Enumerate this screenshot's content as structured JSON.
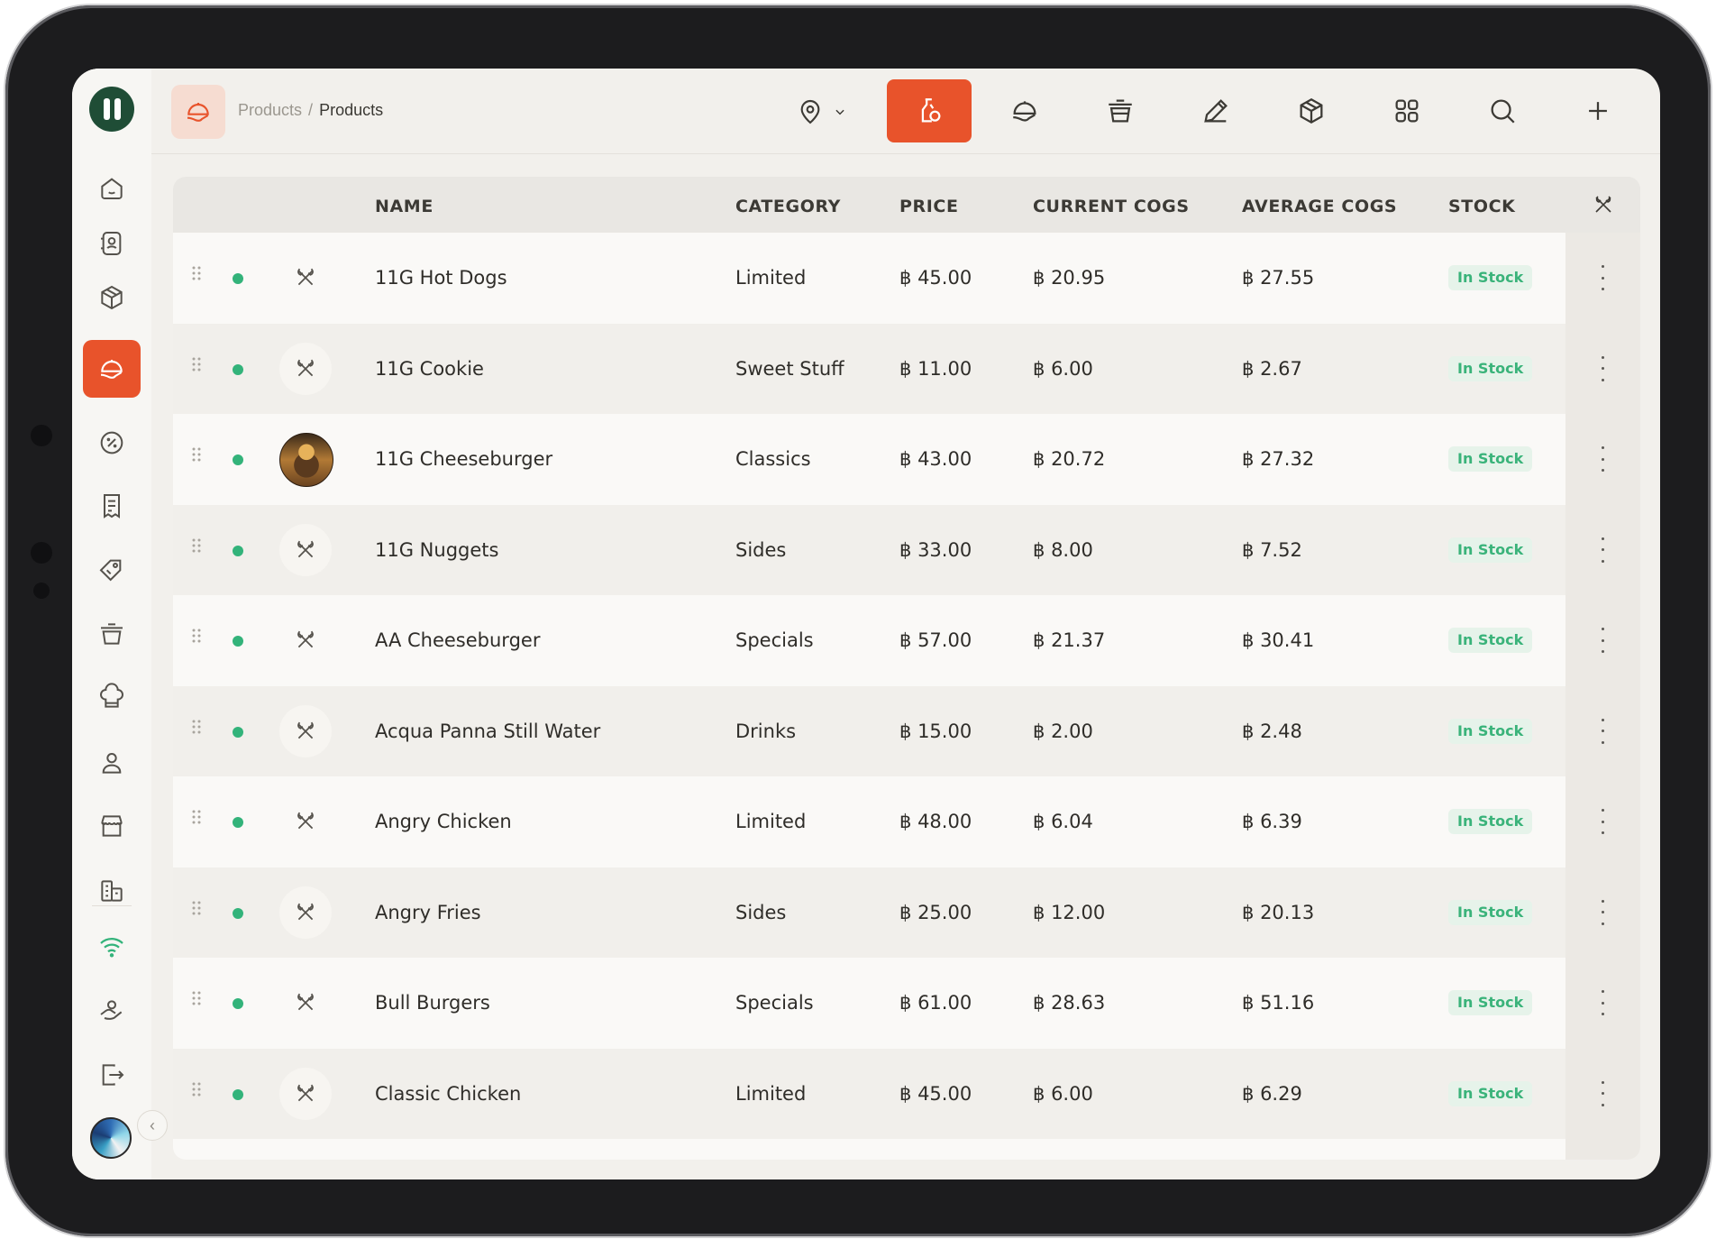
{
  "breadcrumb": {
    "parent": "Products",
    "separator": "/",
    "current": "Products"
  },
  "toolbar": {
    "location_icon": "location-pin-icon",
    "buttons": [
      {
        "name": "ingredients-tab",
        "icon": "bottle-icon",
        "active": true
      },
      {
        "name": "products-tab",
        "icon": "food-tray-icon",
        "active": false
      },
      {
        "name": "pots-tab",
        "icon": "pot-icon",
        "active": false
      },
      {
        "name": "edit-tab",
        "icon": "pencil-icon",
        "active": false
      },
      {
        "name": "packages-tab",
        "icon": "box-icon",
        "active": false
      },
      {
        "name": "grid-tab",
        "icon": "grid-icon",
        "active": false
      },
      {
        "name": "search",
        "icon": "search-icon",
        "active": false
      },
      {
        "name": "add",
        "icon": "plus-icon",
        "active": false
      }
    ]
  },
  "sidebar": {
    "items": [
      {
        "name": "home",
        "icon": "home-icon"
      },
      {
        "name": "contacts",
        "icon": "contact-card-icon"
      },
      {
        "name": "inventory",
        "icon": "box-icon"
      },
      {
        "name": "products",
        "icon": "food-tray-icon",
        "active": true
      },
      {
        "name": "discounts",
        "icon": "percent-badge-icon"
      },
      {
        "name": "invoices",
        "icon": "receipt-icon"
      },
      {
        "name": "tags",
        "icon": "tag-icon"
      },
      {
        "name": "cooking",
        "icon": "pot-icon"
      },
      {
        "name": "chef",
        "icon": "chef-hat-icon"
      },
      {
        "name": "staff",
        "icon": "user-icon"
      },
      {
        "name": "store",
        "icon": "store-icon"
      },
      {
        "name": "buildings",
        "icon": "buildings-icon"
      },
      {
        "name": "connectivity",
        "icon": "wifi-icon"
      },
      {
        "name": "support",
        "icon": "hand-icon"
      },
      {
        "name": "logout",
        "icon": "logout-icon"
      }
    ]
  },
  "table": {
    "columns": [
      "NAME",
      "CATEGORY",
      "PRICE",
      "CURRENT COGS",
      "AVERAGE COGS",
      "STOCK"
    ],
    "currency": "฿",
    "rows": [
      {
        "name": "11G Hot Dogs",
        "category": "Limited",
        "price": "45.00",
        "current_cogs": "20.95",
        "average_cogs": "27.55",
        "stock": "In Stock",
        "thumb": "plain"
      },
      {
        "name": "11G Cookie",
        "category": "Sweet Stuff",
        "price": "11.00",
        "current_cogs": "6.00",
        "average_cogs": "2.67",
        "stock": "In Stock",
        "thumb": "circle"
      },
      {
        "name": "11G Cheeseburger",
        "category": "Classics",
        "price": "43.00",
        "current_cogs": "20.72",
        "average_cogs": "27.32",
        "stock": "In Stock",
        "thumb": "photo"
      },
      {
        "name": "11G Nuggets",
        "category": "Sides",
        "price": "33.00",
        "current_cogs": "8.00",
        "average_cogs": "7.52",
        "stock": "In Stock",
        "thumb": "circle"
      },
      {
        "name": "AA Cheeseburger",
        "category": "Specials",
        "price": "57.00",
        "current_cogs": "21.37",
        "average_cogs": "30.41",
        "stock": "In Stock",
        "thumb": "plain"
      },
      {
        "name": "Acqua Panna Still Water",
        "category": "Drinks",
        "price": "15.00",
        "current_cogs": "2.00",
        "average_cogs": "2.48",
        "stock": "In Stock",
        "thumb": "circle"
      },
      {
        "name": "Angry Chicken",
        "category": "Limited",
        "price": "48.00",
        "current_cogs": "6.04",
        "average_cogs": "6.39",
        "stock": "In Stock",
        "thumb": "plain"
      },
      {
        "name": "Angry Fries",
        "category": "Sides",
        "price": "25.00",
        "current_cogs": "12.00",
        "average_cogs": "20.13",
        "stock": "In Stock",
        "thumb": "circle"
      },
      {
        "name": "Bull Burgers",
        "category": "Specials",
        "price": "61.00",
        "current_cogs": "28.63",
        "average_cogs": "51.16",
        "stock": "In Stock",
        "thumb": "plain"
      },
      {
        "name": "Classic Chicken",
        "category": "Limited",
        "price": "45.00",
        "current_cogs": "6.00",
        "average_cogs": "6.29",
        "stock": "In Stock",
        "thumb": "circle"
      }
    ]
  },
  "colors": {
    "accent": "#e8532b",
    "brand": "#1f4d36",
    "in_stock": "#3ab37a"
  }
}
